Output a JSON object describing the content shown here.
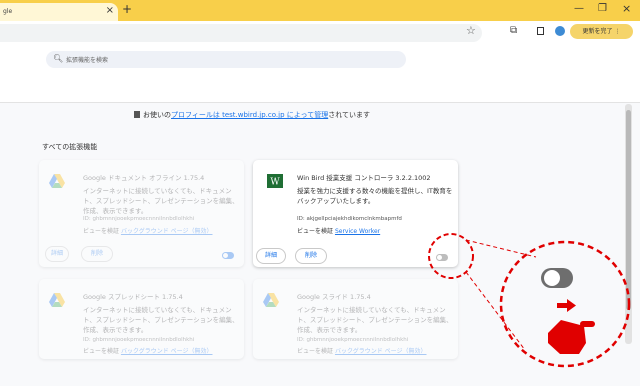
{
  "browser": {
    "tab_title": "gle",
    "tab_close": "×",
    "new_tab": "+",
    "minimize": "—",
    "maximize": "❐",
    "close": "×",
    "update_label": "更新を完了 ⋮"
  },
  "search": {
    "placeholder": "拡張機能を検索"
  },
  "managed_notice": {
    "prefix": "お使いの",
    "link_text": "プロフィールは test.wbird.jp.co.jp によって管理",
    "suffix": "されています"
  },
  "section_title": "すべての拡張機能",
  "cards": [
    {
      "name": "Google ドキュメント オフライン 1.75.4",
      "desc": "インターネットに接続していなくても、ドキュメント、スプレッドシート、プレゼンテーションを編集、作成、表示できます。",
      "id": "ID: ghbmnnjooekpmoecnnnilnnbdlolhkhi",
      "view_prefix": "ビューを検証",
      "view_link": "バックグラウンド ページ（無効）",
      "details": "詳細",
      "remove": "削除"
    },
    {
      "name": "Win Bird 授業支援 コントローラ 3.2.2.1002",
      "desc": "授業を強力に支援する数々の機能を提供し、IT教育をバックアップいたします。",
      "id": "ID: akjgellpciajekhdikomclnkmbapmfd",
      "view_prefix": "ビューを検証",
      "view_link": "Service Worker",
      "details": "詳細",
      "remove": "削除"
    },
    {
      "name": "Google スプレッドシート 1.75.4",
      "desc": "インターネットに接続していなくても、ドキュメント、スプレッドシート、プレゼンテーションを編集、作成、表示できます。",
      "id": "ID: ghbmnnjooekpmoecnnnilnnbdlolhkhi",
      "view_prefix": "ビューを検証",
      "view_link": "バックグラウンド ページ（無効）"
    },
    {
      "name": "Google スライド 1.75.4",
      "desc": "インターネットに接続していなくても、ドキュメント、スプレッドシート、プレゼンテーションを編集、作成、表示できます。",
      "id": "ID: ghbmnnjooekpmoecnnnilnnbdlolhkhi",
      "view_prefix": "ビューを検証",
      "view_link": "バックグラウンド ページ（無効）"
    }
  ],
  "colors": {
    "titlebar": "#f8cf4a",
    "accent": "#1a73e8",
    "annotation": "#e00000"
  },
  "icons": [
    "star-icon",
    "extensions-icon",
    "side-panel-icon",
    "avatar",
    "search-icon",
    "building-icon",
    "drive-logo-icon",
    "winbird-logo-icon",
    "hand-pointer-icon",
    "arrow-right-icon"
  ]
}
